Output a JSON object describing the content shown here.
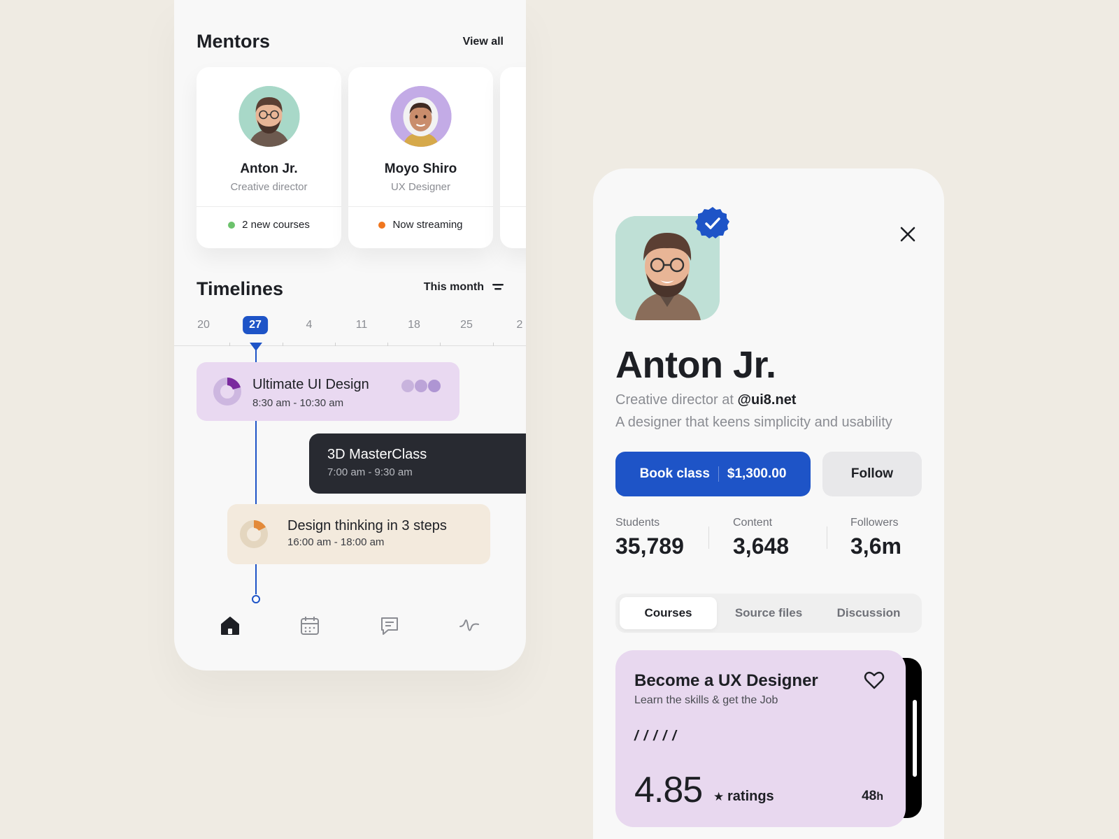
{
  "mentors_section": {
    "title": "Mentors",
    "view_all": "View all",
    "mentors": [
      {
        "name": "Anton Jr.",
        "role": "Creative director",
        "status": "2 new courses",
        "status_color": "#6cc26c"
      },
      {
        "name": "Moyo Shiro",
        "role": "UX Designer",
        "status": "Now streaming",
        "status_color": "#f0761e"
      }
    ]
  },
  "timelines_section": {
    "title": "Timelines",
    "filter_label": "This month",
    "dates": [
      "20",
      "27",
      "4",
      "11",
      "18",
      "25",
      "2"
    ],
    "active_date": "27",
    "events": [
      {
        "title": "Ultimate UI Design",
        "time": "8:30 am - 10:30 am"
      },
      {
        "title": "3D MasterClass",
        "time": "7:00 am - 9:30 am"
      },
      {
        "title": "Design thinking in 3 steps",
        "time": "16:00 am - 18:00 am"
      }
    ]
  },
  "bottom_nav": {
    "items": [
      "home-icon",
      "calendar-icon",
      "chat-icon",
      "activity-icon"
    ],
    "active": "home-icon"
  },
  "profile": {
    "name": "Anton Jr.",
    "subtitle_prefix": "Creative director at ",
    "subtitle_handle": "@ui8.net",
    "bio": "A designer that keens simplicity and usability",
    "book_label": "Book class",
    "book_price": "$1,300.00",
    "follow_label": "Follow",
    "stats": [
      {
        "label": "Students",
        "value": "35,789"
      },
      {
        "label": "Content",
        "value": "3,648"
      },
      {
        "label": "Followers",
        "value": "3,6m"
      }
    ],
    "tabs": [
      "Courses",
      "Source files",
      "Discussion"
    ],
    "active_tab": "Courses"
  },
  "course": {
    "title": "Become a UX Designer",
    "subtitle": "Learn the skills & get the Job",
    "slashes": "/////",
    "rating": "4.85",
    "rating_star": "★",
    "rating_label": "ratings",
    "duration_value": "48",
    "duration_unit": "h"
  },
  "colors": {
    "accent": "#1e54c7",
    "event_purple": "#e9d9f1",
    "event_dark": "#282a31",
    "event_beige": "#f3eadd",
    "background": "#efebe3"
  }
}
